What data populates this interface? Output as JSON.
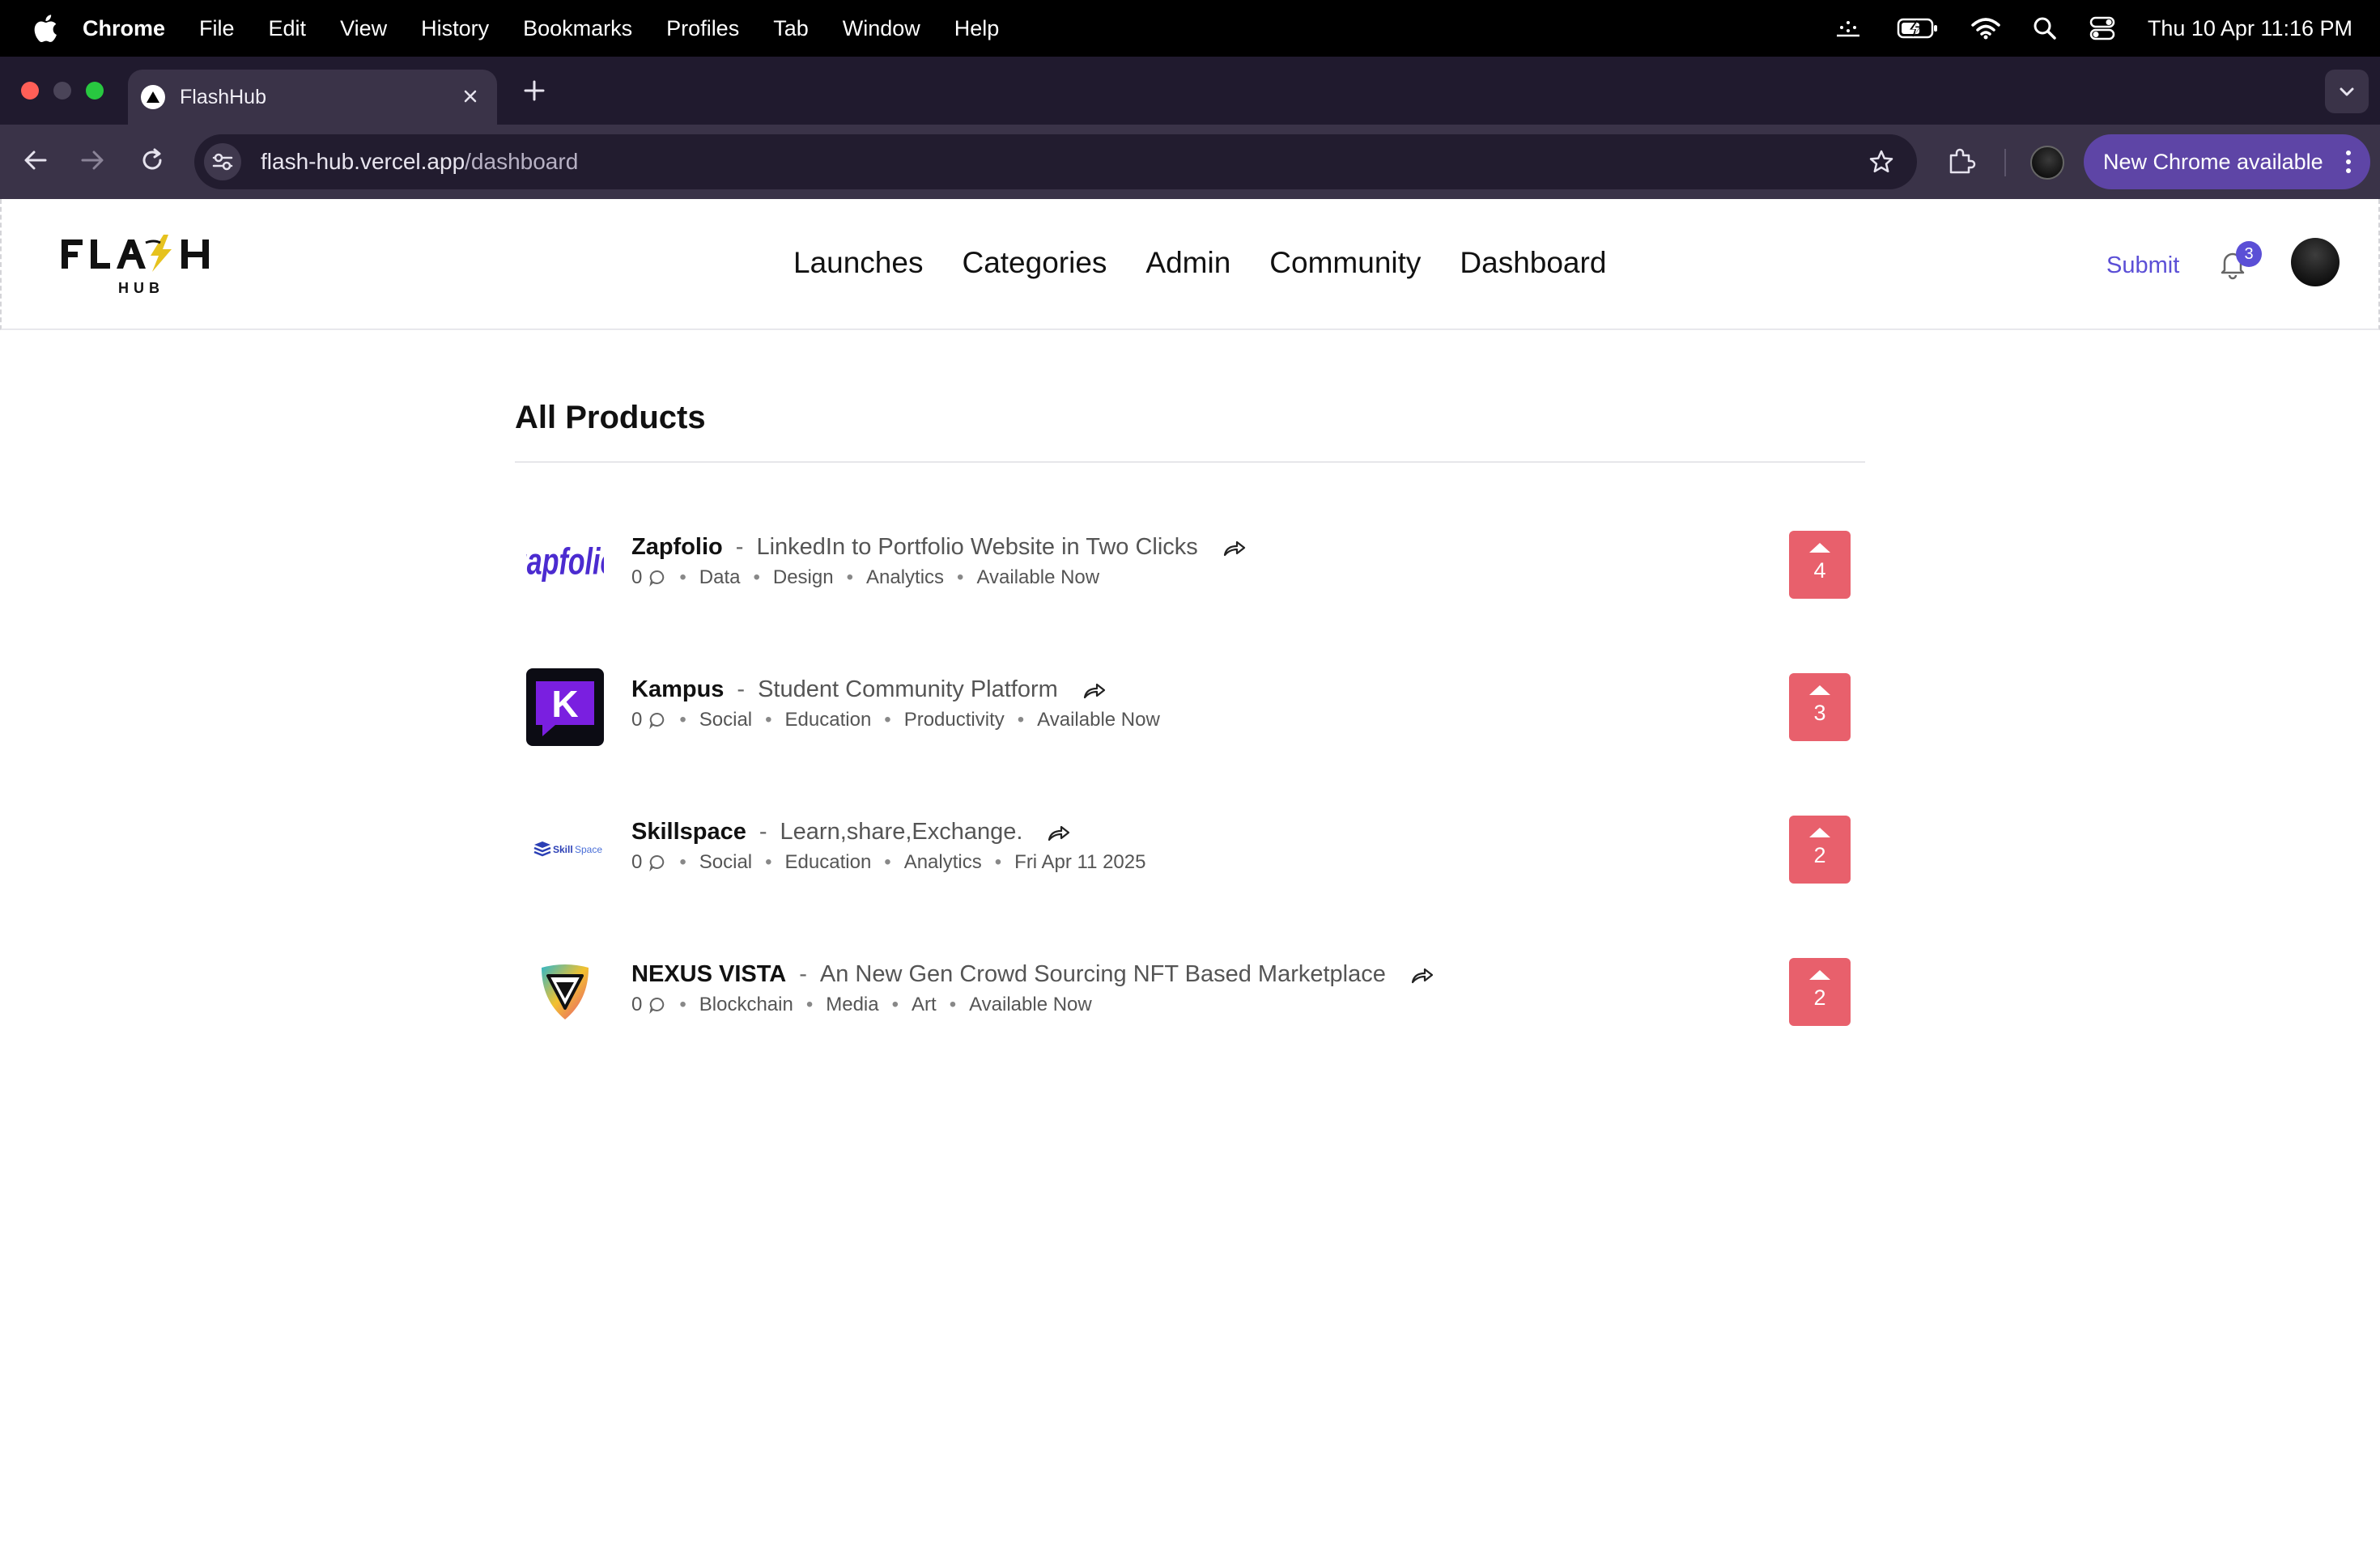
{
  "menubar": {
    "app": "Chrome",
    "items": [
      "File",
      "Edit",
      "View",
      "History",
      "Bookmarks",
      "Profiles",
      "Tab",
      "Window",
      "Help"
    ],
    "clock": "Thu 10 Apr  11:16 PM"
  },
  "browser": {
    "tab_title": "FlashHub",
    "url_host": "flash-hub.vercel.app",
    "url_path": "/dashboard",
    "new_chrome": "New Chrome available"
  },
  "site": {
    "logo_text": "FLA⚡H",
    "logo_sub": "HUB",
    "nav": [
      "Launches",
      "Categories",
      "Admin",
      "Community",
      "Dashboard"
    ],
    "submit": "Submit",
    "notification_count": "3"
  },
  "main": {
    "title": "All Products",
    "products": [
      {
        "name": "Zapfolio",
        "tagline": "LinkedIn to Portfolio Website in Two Clicks",
        "comments": "0",
        "tags": [
          "Data",
          "Design",
          "Analytics"
        ],
        "status": "Available Now",
        "votes": "4",
        "logo": "zapfolio-logo"
      },
      {
        "name": "Kampus",
        "tagline": "Student Community Platform",
        "comments": "0",
        "tags": [
          "Social",
          "Education",
          "Productivity"
        ],
        "status": "Available Now",
        "votes": "3",
        "logo": "kampus-logo"
      },
      {
        "name": "Skillspace",
        "tagline": "Learn,share,Exchange.",
        "comments": "0",
        "tags": [
          "Social",
          "Education",
          "Analytics"
        ],
        "status": "Fri Apr 11 2025",
        "votes": "2",
        "logo": "skillspace-logo"
      },
      {
        "name": "NEXUS VISTA",
        "tagline": "An New Gen Crowd Sourcing NFT Based Marketplace",
        "comments": "0",
        "tags": [
          "Blockchain",
          "Media",
          "Art"
        ],
        "status": "Available Now",
        "votes": "2",
        "logo": "nexus-vista-logo"
      }
    ]
  },
  "colors": {
    "accent": "#5b4fd6",
    "vote": "#e8606c",
    "browser_bg": "#3a3348"
  }
}
